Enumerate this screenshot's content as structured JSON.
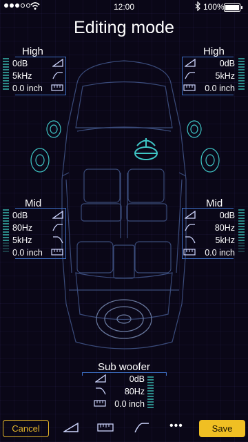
{
  "status_bar": {
    "time": "12:00",
    "battery": "100%"
  },
  "title": "Editing mode",
  "front_left": {
    "label": "High",
    "gain": "0dB",
    "freq": "5kHz",
    "distance": "0.0 inch"
  },
  "front_right": {
    "label": "High",
    "gain": "0dB",
    "freq": "5kHz",
    "distance": "0.0 inch"
  },
  "mid_left": {
    "label": "Mid",
    "gain": "0dB",
    "hpf": "80Hz",
    "lpf": "5kHz",
    "distance": "0.0 inch"
  },
  "mid_right": {
    "label": "Mid",
    "gain": "0dB",
    "hpf": "80Hz",
    "lpf": "5kHz",
    "distance": "0.0 inch"
  },
  "subwoofer": {
    "label": "Sub woofer",
    "gain": "0dB",
    "lpf": "80Hz",
    "distance": "0.0 inch"
  },
  "toolbar": {
    "cancel_label": "Cancel",
    "save_label": "Save",
    "more_label": "•••"
  },
  "colors": {
    "accent": "#f0bf23",
    "bracket": "#3d6fc4",
    "car_outline": "#3a4b7a",
    "speaker": "#3fc6c6"
  },
  "icons": [
    "level-icon",
    "highpass-icon",
    "lowpass-icon",
    "ruler-icon",
    "steering-wheel-icon"
  ]
}
